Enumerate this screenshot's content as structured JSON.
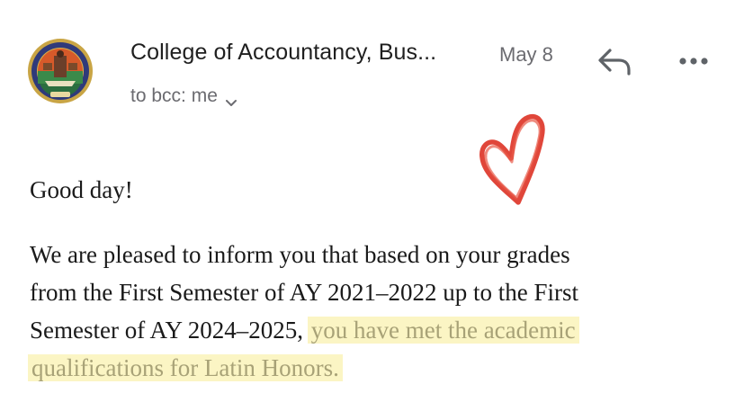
{
  "email": {
    "sender": "College of Accountancy, Bus...",
    "date": "May 8",
    "recipients": "to bcc: me"
  },
  "body": {
    "greeting": "Good day!",
    "line1": "We are pleased to inform you that based on your grades",
    "line2": "from the First Semester of AY 2021–2022 up to the First",
    "line3_plain": "Semester of AY 2024–2025,",
    "line3_highlight": "you have met the academic",
    "line4_highlight": "qualifications for Latin Honors."
  },
  "icons": {
    "avatar": "college-seal-logo",
    "reply": "reply-icon",
    "more": "more-horizontal-icon",
    "chevron": "chevron-down-icon",
    "drawing": "hand-drawn-heart"
  },
  "colors": {
    "highlight_bg": "#fbf5c4",
    "highlight_text": "#a8a277",
    "heart": "#e0463a",
    "secondary_text": "#6b6b70"
  }
}
